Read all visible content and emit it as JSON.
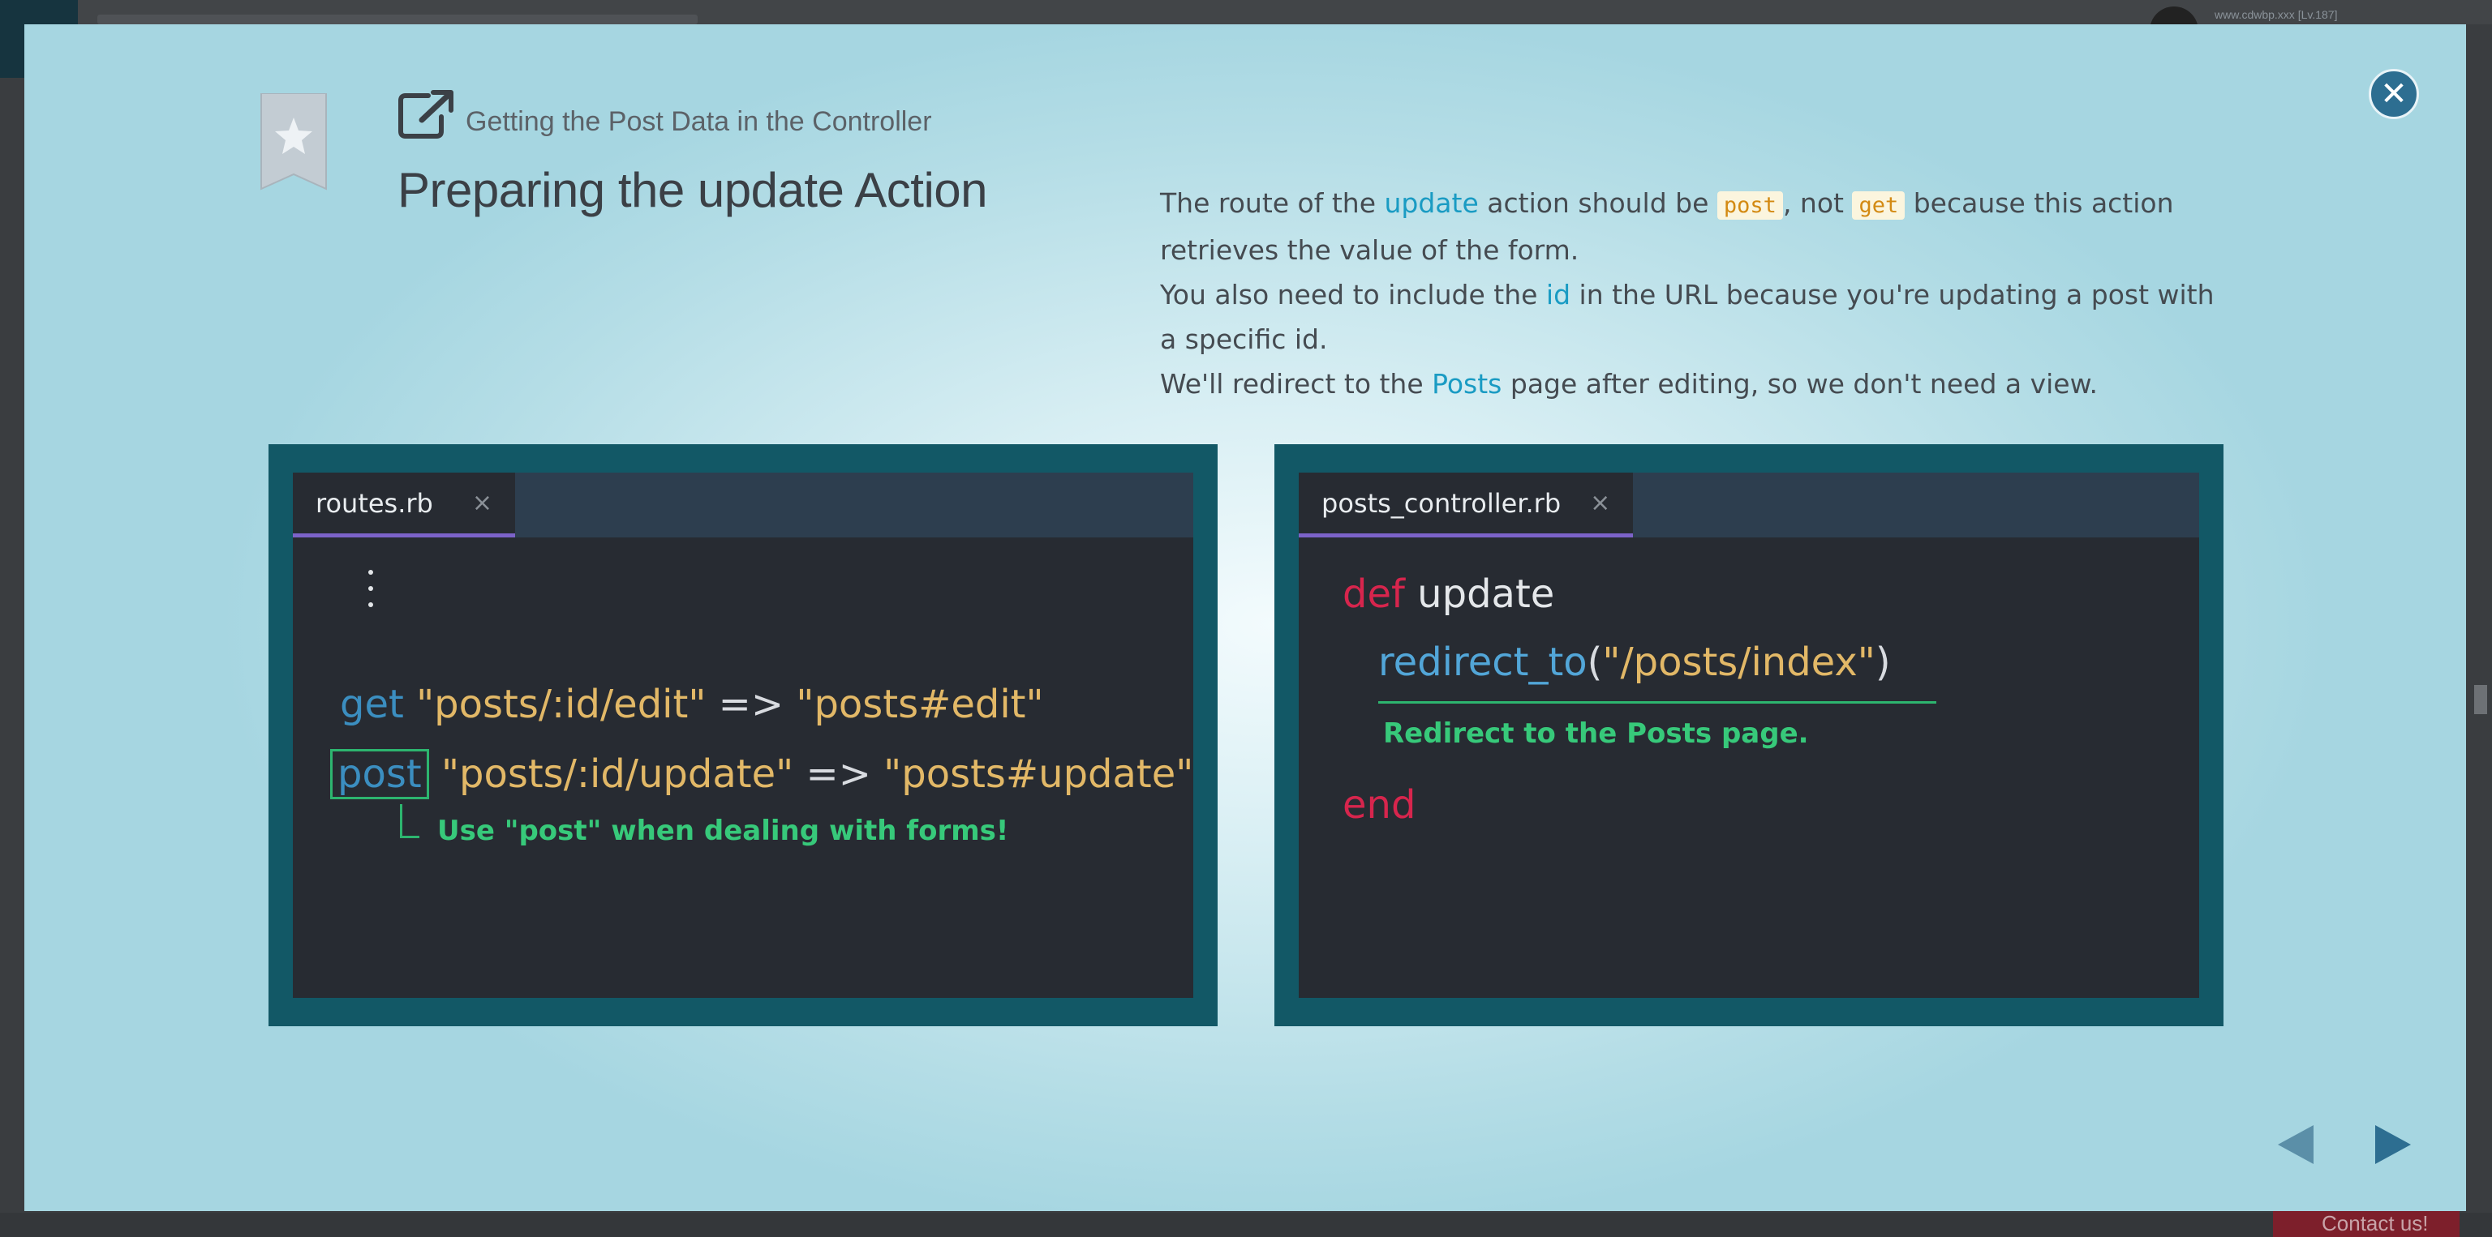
{
  "background_app": {
    "user_text": "www.cdwbp.xxx [Lv.187]",
    "contact_label": "Contact us!"
  },
  "modal": {
    "subtitle": "Getting the Post Data in the Controller",
    "title": "Preparing the update Action",
    "description": {
      "p1_a": "The route of the ",
      "p1_link": "update",
      "p1_b": " action should be ",
      "p1_code1": "post",
      "p1_c": ", not ",
      "p1_code2": "get",
      "p1_d": " because this action retrieves the value of the form.",
      "p2_a": "You also need to include the ",
      "p2_link": "id",
      "p2_b": " in the URL because you're updating a post with a specific id.",
      "p3_a": "We'll redirect to the ",
      "p3_link": "Posts",
      "p3_b": " page after editing, so we don't need a view."
    },
    "left_panel": {
      "tab_label": "routes.rb",
      "tab_close": "×",
      "line1_kw": "get",
      "line1_str1": "\"posts/:id/edit\"",
      "line1_op": " => ",
      "line1_str2": "\"posts#edit\"",
      "line2_kw": "post",
      "line2_str1": "\"posts/:id/update\"",
      "line2_op": " => ",
      "line2_str2": "\"posts#update\"",
      "note": "Use \"post\" when dealing with forms!"
    },
    "right_panel": {
      "tab_label": "posts_controller.rb",
      "tab_close": "×",
      "line1_def": "def",
      "line1_name": "update",
      "line2_fn": "redirect_to",
      "line2_paren_open": "(",
      "line2_str": "\"/posts/index\"",
      "line2_paren_close": ")",
      "note": "Redirect to the Posts page.",
      "line3_end": "end"
    },
    "icons": {
      "bookmark": "bookmark-star-icon",
      "external": "external-link-icon",
      "close": "close-icon",
      "prev": "prev-arrow-icon",
      "next": "next-arrow-icon"
    }
  }
}
